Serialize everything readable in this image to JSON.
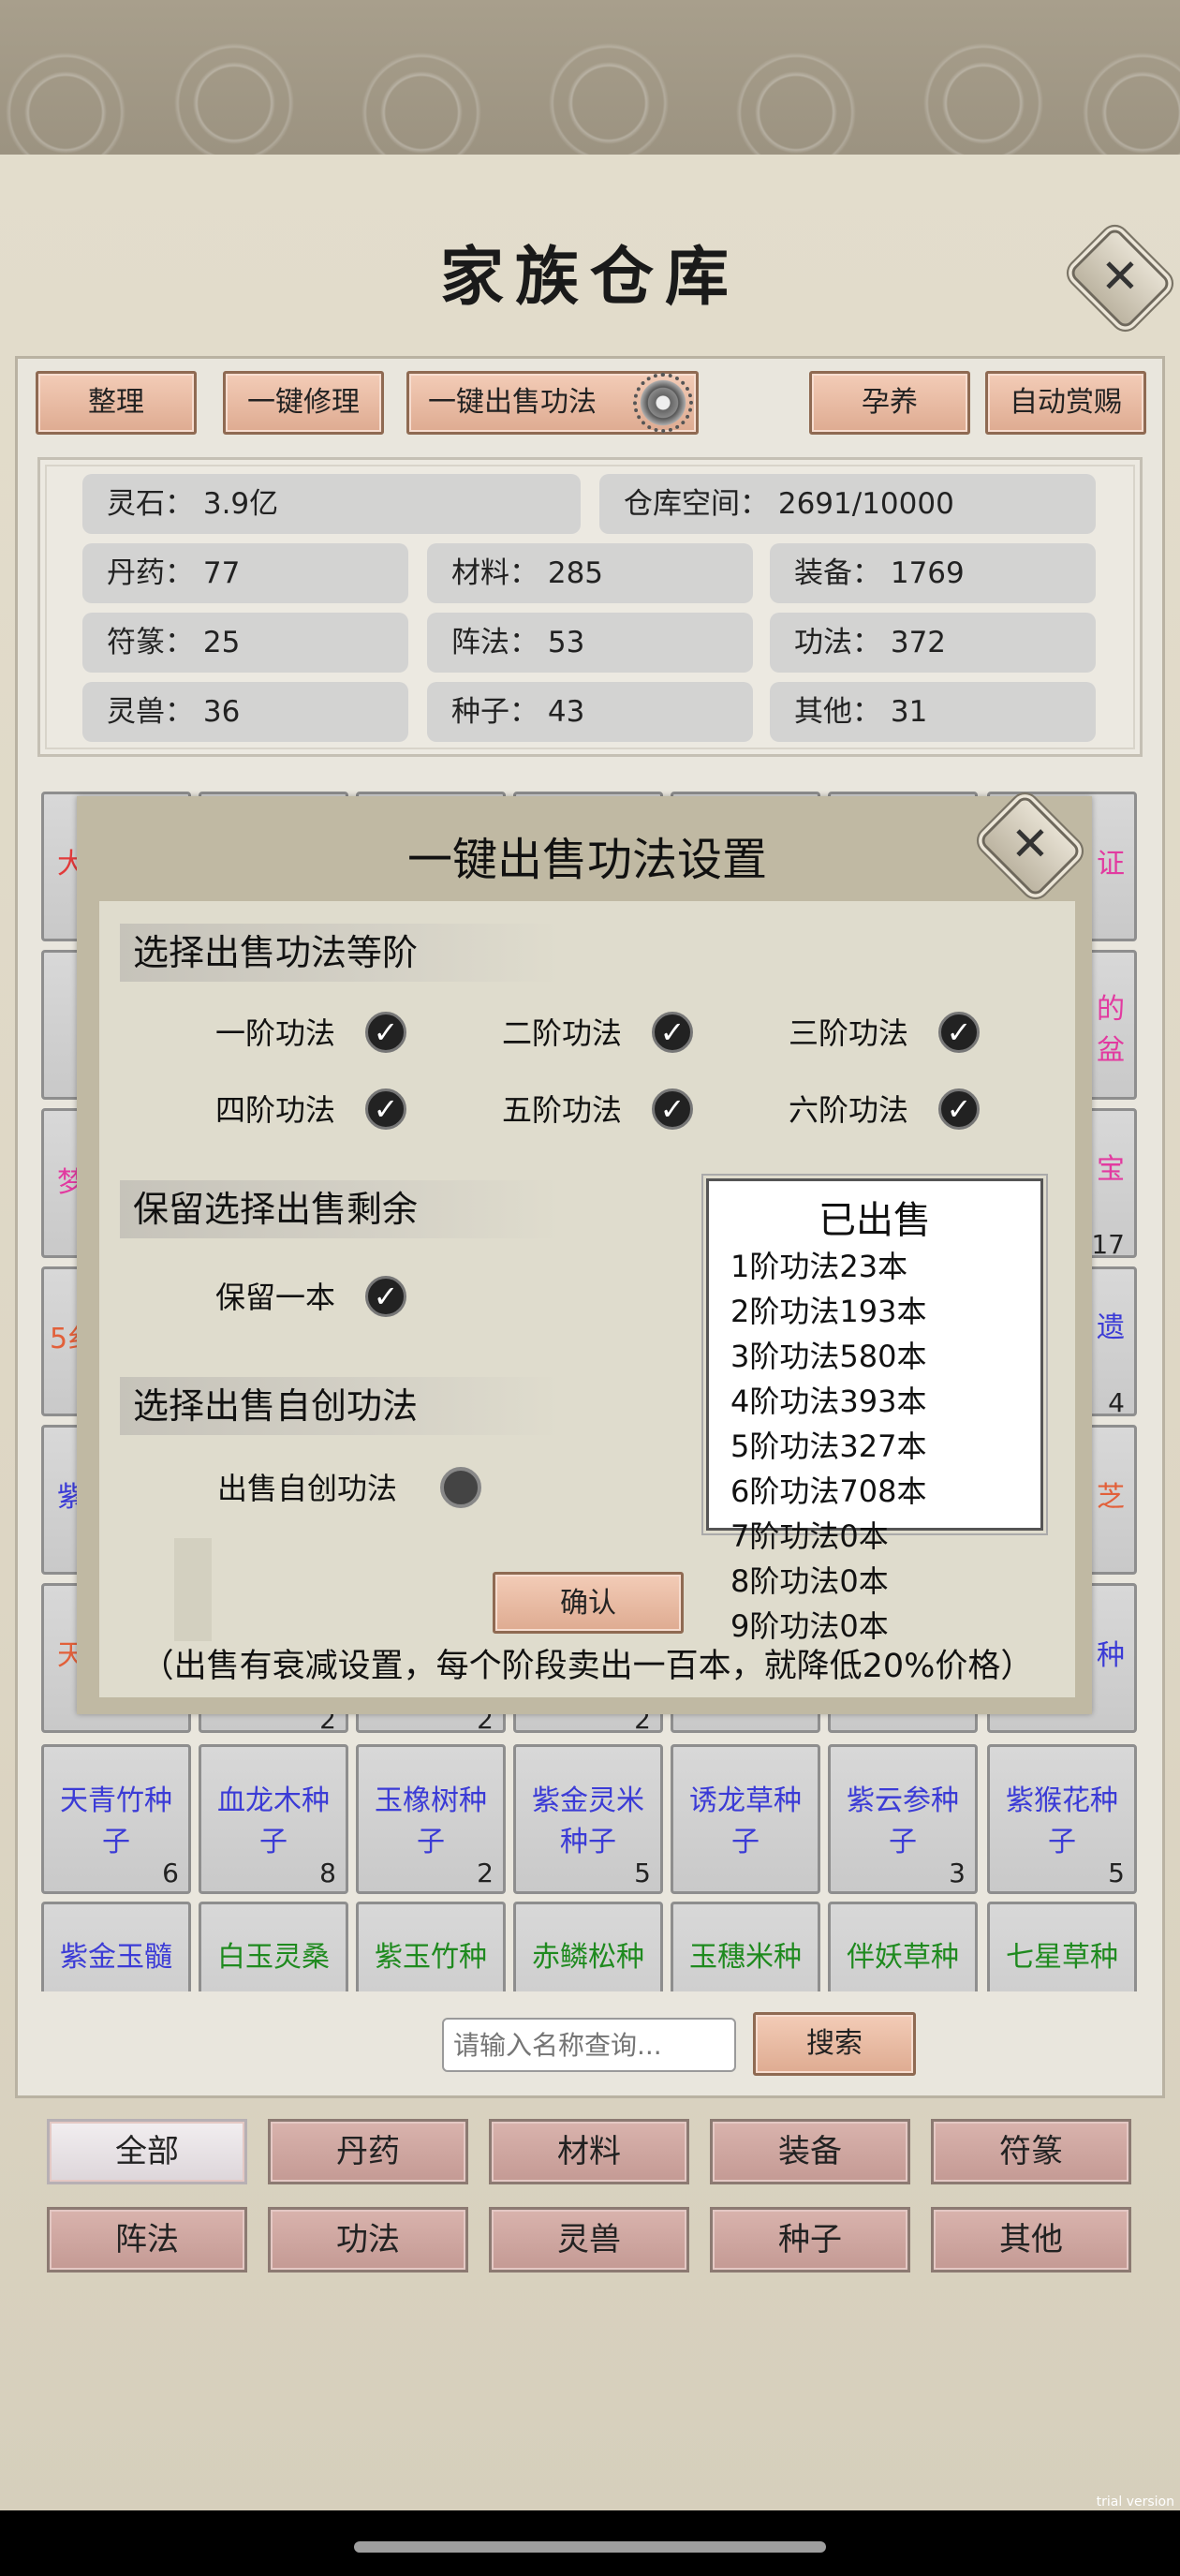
{
  "header": {
    "title": "家族仓库"
  },
  "toolbar": {
    "sort_label": "整理",
    "repair_label": "一键修理",
    "sell_skills_label": "一键出售功法",
    "nurture_label": "孕养",
    "auto_reward_label": "自动赏赐"
  },
  "stats": {
    "spirit_stone": "灵石：  3.9亿",
    "storage_space": "仓库空间：    2691/10000",
    "pills": "丹药：  77",
    "materials": "材料：  285",
    "equipment": "装备：  1769",
    "talismans": "符篆：  25",
    "formations": "阵法：  53",
    "skills": "功法：  372",
    "beasts": "灵兽：  36",
    "seeds": "种子：  43",
    "others": "其他：  31"
  },
  "grid_peek": {
    "left_col": [
      "大",
      "梦",
      "5纟",
      "紫",
      "天"
    ],
    "right_col": [
      "证",
      "的",
      "盆",
      "宝",
      "遗",
      "芝",
      "种"
    ],
    "right_counts": [
      "17",
      "4"
    ],
    "bottom_counts": [
      "2",
      "2",
      "2"
    ]
  },
  "items_row1": [
    {
      "name": "天青竹种子",
      "count": "6",
      "color": "#3b3bd6"
    },
    {
      "name": "血龙木种子",
      "count": "8",
      "color": "#3b3bd6"
    },
    {
      "name": "玉橡树种子",
      "count": "2",
      "color": "#3b3bd6"
    },
    {
      "name": "紫金灵米种子",
      "count": "5",
      "color": "#3b3bd6"
    },
    {
      "name": "诱龙草种子",
      "count": "",
      "color": "#3b3bd6"
    },
    {
      "name": "紫云参种子",
      "count": "3",
      "color": "#3b3bd6"
    },
    {
      "name": "紫猴花种子",
      "count": "5",
      "color": "#3b3bd6"
    }
  ],
  "items_row2": [
    {
      "name": "紫金玉髓",
      "color": "#3b3bd6"
    },
    {
      "name": "白玉灵桑",
      "color": "#1f8a1f"
    },
    {
      "name": "紫玉竹种",
      "color": "#1f8a1f"
    },
    {
      "name": "赤鳞松种",
      "color": "#1f8a1f"
    },
    {
      "name": "玉穗米种",
      "color": "#1f8a1f"
    },
    {
      "name": "伴妖草种",
      "color": "#1f8a1f"
    },
    {
      "name": "七星草种",
      "color": "#1f8a1f"
    }
  ],
  "search": {
    "placeholder": "请输入名称查询...",
    "button_label": "搜索"
  },
  "categories": [
    "全部",
    "丹药",
    "材料",
    "装备",
    "符篆",
    "阵法",
    "功法",
    "灵兽",
    "种子",
    "其他"
  ],
  "modal": {
    "title": "一键出售功法设置",
    "section_tier": "选择出售功法等阶",
    "tiers": [
      "一阶功法",
      "二阶功法",
      "三阶功法",
      "四阶功法",
      "五阶功法",
      "六阶功法"
    ],
    "section_keep": "保留选择出售剩余",
    "keep_one": "保留一本",
    "section_self": "选择出售自创功法",
    "sell_self": "出售自创功法",
    "sold_title": "已出售",
    "sold_lines": [
      "1阶功法23本",
      "2阶功法193本",
      "3阶功法580本",
      "4阶功法393本",
      "5阶功法327本",
      "6阶功法708本",
      "7阶功法0本",
      "8阶功法0本",
      "9阶功法0本"
    ],
    "confirm_label": "确认",
    "footnote": "（出售有衰减设置，每个阶段卖出一百本，就降低20%价格）"
  },
  "system": {
    "trial_text": "trial version"
  },
  "colors": {
    "accent_button": "#deab91",
    "panel": "#e9e6dd",
    "blue_item": "#3b3bd6",
    "green_item": "#1f8a1f"
  }
}
